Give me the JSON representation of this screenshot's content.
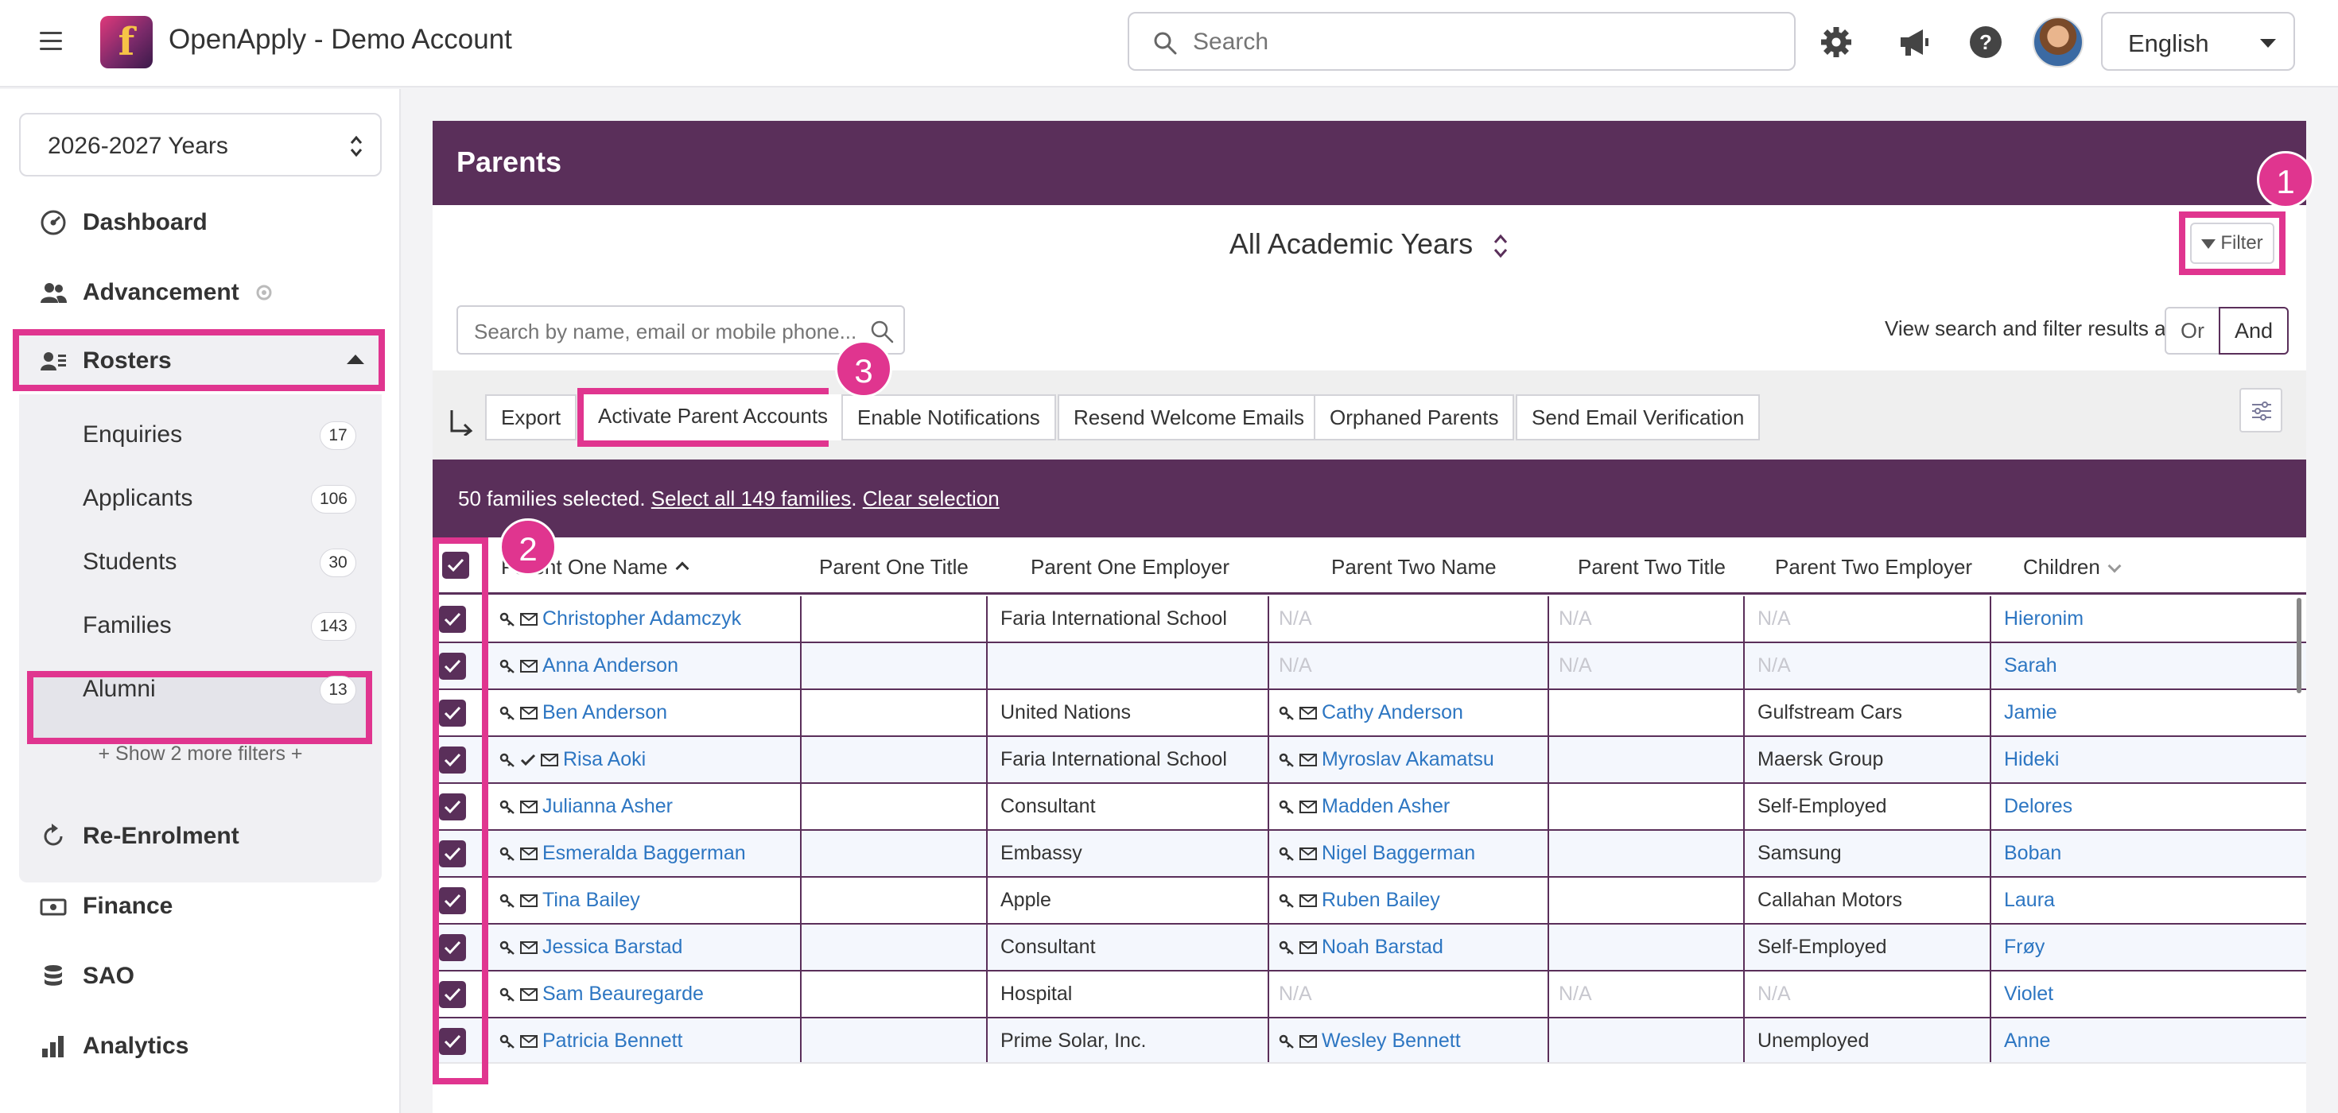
{
  "topbar": {
    "app_title": "OpenApply - Demo Account",
    "search_placeholder": "Search",
    "language": "English",
    "icons": [
      "menu-icon",
      "settings-gear-icon",
      "megaphone-icon",
      "help-icon",
      "user-avatar"
    ]
  },
  "sidebar": {
    "year_select": "2026-2027 Years",
    "items": [
      {
        "label": "Dashboard",
        "icon": "dashboard-icon"
      },
      {
        "label": "Advancement",
        "icon": "users-icon"
      },
      {
        "label": "Rosters",
        "icon": "roster-icon"
      },
      {
        "label": "Re-Enrolment",
        "icon": "refresh-icon"
      },
      {
        "label": "Finance",
        "icon": "money-icon"
      },
      {
        "label": "SAO",
        "icon": "database-icon"
      },
      {
        "label": "Analytics",
        "icon": "bar-chart-icon"
      }
    ],
    "roster_sub": [
      {
        "label": "Enquiries",
        "count": "17"
      },
      {
        "label": "Applicants",
        "count": "106"
      },
      {
        "label": "Students",
        "count": "30"
      },
      {
        "label": "Families",
        "count": "143"
      },
      {
        "label": "Alumni",
        "count": "13"
      }
    ],
    "show_more": "+ Show 2 more filters +"
  },
  "main": {
    "title": "Parents",
    "academic_years": "All Academic Years",
    "filter_label": "Filter",
    "search_placeholder": "Search by name, email or mobile phone...",
    "view_as_label": "View search and filter results as:",
    "view_or": "Or",
    "view_and": "And",
    "toolbar": {
      "export": "Export",
      "activate": "Activate Parent Accounts",
      "enable_notifications": "Enable Notifications",
      "resend_welcome": "Resend Welcome Emails",
      "orphaned": "Orphaned Parents",
      "send_verification": "Send Email Verification"
    },
    "selection": {
      "text": "50 families selected.",
      "select_all": "Select all 149 families",
      "clear": "Clear selection"
    },
    "badges": [
      "1",
      "2",
      "3"
    ]
  },
  "table": {
    "columns": [
      "Parent One Name",
      "Parent One Title",
      "Parent One Employer",
      "Parent Two Name",
      "Parent Two Title",
      "Parent Two Employer",
      "Children"
    ],
    "rows": [
      {
        "p1": "Christopher Adamczyk",
        "p1_check": false,
        "p1_title": "",
        "p1_emp": "Faria International School",
        "p2": "N/A",
        "p2_title": "N/A",
        "p2_emp": "N/A",
        "child": "Hieronim"
      },
      {
        "p1": "Anna Anderson",
        "p1_check": false,
        "p1_title": "",
        "p1_emp": "",
        "p2": "N/A",
        "p2_title": "N/A",
        "p2_emp": "N/A",
        "child": "Sarah"
      },
      {
        "p1": "Ben Anderson",
        "p1_check": false,
        "p1_title": "",
        "p1_emp": "United Nations",
        "p2": "Cathy Anderson",
        "p2_title": "",
        "p2_emp": "Gulfstream Cars",
        "child": "Jamie"
      },
      {
        "p1": "Risa Aoki",
        "p1_check": true,
        "p1_title": "",
        "p1_emp": "Faria International School",
        "p2": "Myroslav Akamatsu",
        "p2_title": "",
        "p2_emp": "Maersk Group",
        "child": "Hideki"
      },
      {
        "p1": "Julianna Asher",
        "p1_check": false,
        "p1_title": "",
        "p1_emp": "Consultant",
        "p2": "Madden Asher",
        "p2_title": "",
        "p2_emp": "Self-Employed",
        "child": "Delores"
      },
      {
        "p1": "Esmeralda Baggerman",
        "p1_check": false,
        "p1_title": "",
        "p1_emp": "Embassy",
        "p2": "Nigel Baggerman",
        "p2_title": "",
        "p2_emp": "Samsung",
        "child": "Boban"
      },
      {
        "p1": "Tina Bailey",
        "p1_check": false,
        "p1_title": "",
        "p1_emp": "Apple",
        "p2": "Ruben Bailey",
        "p2_title": "",
        "p2_emp": "Callahan Motors",
        "child": "Laura"
      },
      {
        "p1": "Jessica Barstad",
        "p1_check": false,
        "p1_title": "",
        "p1_emp": "Consultant",
        "p2": "Noah Barstad",
        "p2_title": "",
        "p2_emp": "Self-Employed",
        "child": "Frøy"
      },
      {
        "p1": "Sam Beauregarde",
        "p1_check": false,
        "p1_title": "",
        "p1_emp": "Hospital",
        "p2": "N/A",
        "p2_title": "N/A",
        "p2_emp": "N/A",
        "child": "Violet"
      },
      {
        "p1": "Patricia Bennett",
        "p1_check": false,
        "p1_title": "",
        "p1_emp": "Prime Solar, Inc.",
        "p2": "Wesley Bennett",
        "p2_title": "",
        "p2_emp": "Unemployed",
        "child": "Anne"
      }
    ]
  },
  "colors": {
    "brand_purple": "#5a2f5a",
    "highlight_pink": "#e0358f",
    "link_blue": "#2d76c2"
  }
}
